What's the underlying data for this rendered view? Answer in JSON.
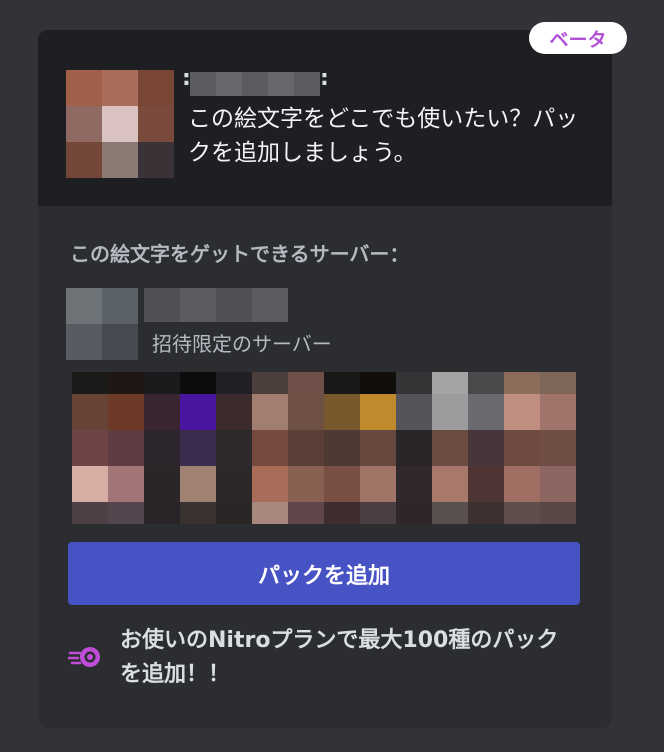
{
  "popout": {
    "beta_label": "ベータ",
    "emoji_description": "この絵文字をどこでも使いたい？パックを追加しましょう。",
    "section_title": "この絵文字をゲットできるサーバー：",
    "server_subtitle": "招待限定のサーバー",
    "add_pack_label": "パックを追加",
    "nitro_promo": "お使いのNitroプランで最大100種のパックを追加！！",
    "nitro_icon": "nitro-icon",
    "colors": {
      "background": "#313338",
      "popout": "#2b2d31",
      "popout_top": "#1e1f22",
      "button": "#4752c4",
      "beta_text": "#b04fd6",
      "nitro_accent": "#c04dd8"
    }
  }
}
